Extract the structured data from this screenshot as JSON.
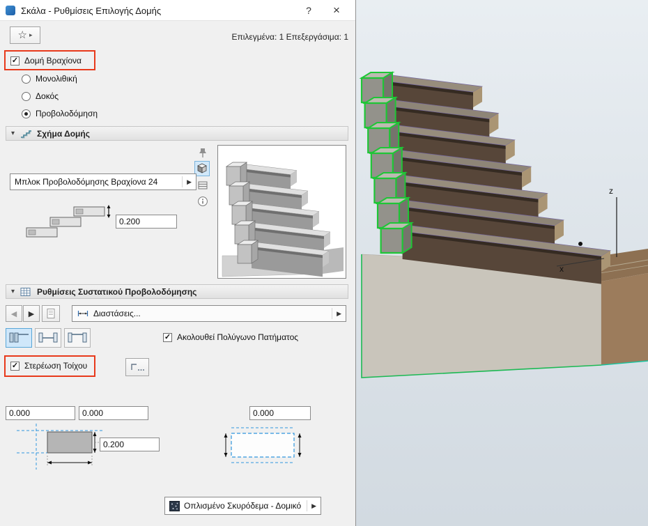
{
  "titlebar": {
    "title": "Σκάλα - Ρυθμίσεις Επιλογής Δομής",
    "help": "?",
    "close": "×"
  },
  "toolbar": {
    "selection_info": "Επιλεγμένα: 1 Επεξεργάσιμα: 1"
  },
  "structure": {
    "label": "Δομή Βραχίονα",
    "options": [
      {
        "label": "Μονολιθική",
        "selected": false
      },
      {
        "label": "Δοκός",
        "selected": false
      },
      {
        "label": "Προβολοδόμηση",
        "selected": true
      }
    ],
    "selected_option": "Προβολοδόμηση"
  },
  "shape_section": {
    "title": "Σχήμα Δομής",
    "block_dropdown": "Μπλοκ Προβολοδόμησης Βραχίονα 24",
    "thickness": "0.200"
  },
  "component_section": {
    "title": "Ρυθμίσεις Συστατικού Προβολοδόμησης",
    "dimensions_dropdown": "Διαστάσεις...",
    "follow_polygon": "Ακολουθεί Πολύγωνο Πατήματος",
    "wall_fixing": "Στερέωση Τοίχου",
    "offset_left": "0.000",
    "offset_center": "0.000",
    "offset_right": "0.000",
    "slab_thickness": "0.200",
    "material_dropdown": "Οπλισμένο Σκυρόδεμα - Δομικό"
  },
  "viewport": {
    "axis_z": "z",
    "axis_x": "x"
  },
  "glyphs": {
    "star": "☆",
    "flyout": "▸",
    "collapse": "▾",
    "nav_left": "◀",
    "nav_right": "▶",
    "popup": "▶",
    "check": "✓"
  },
  "colors": {
    "highlight_red": "#e8391b",
    "selection_green": "#1ec636",
    "guide_blue": "#2f96de"
  }
}
